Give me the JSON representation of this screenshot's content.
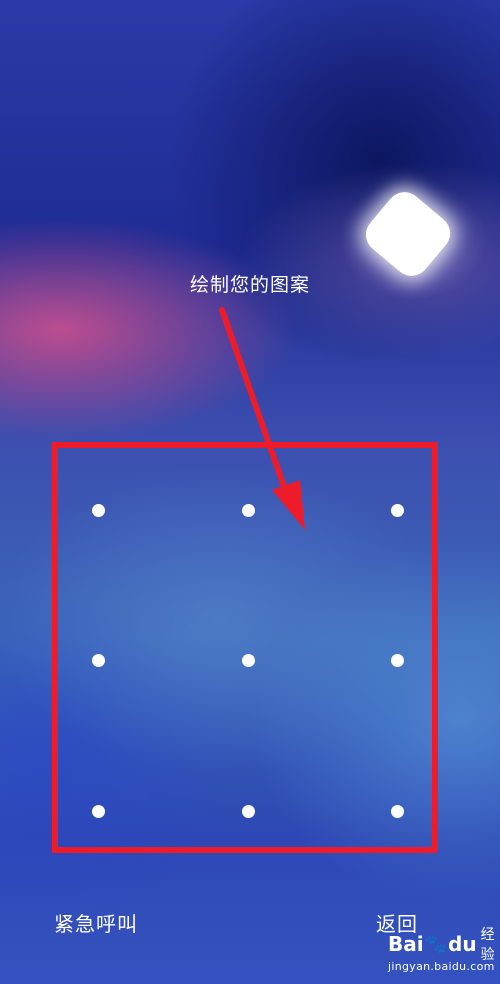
{
  "lockscreen": {
    "prompt": "绘制您的图案",
    "emergency_call": "紧急呼叫",
    "back": "返回"
  },
  "pattern": {
    "rows": 3,
    "cols": 3
  },
  "annotation": {
    "color": "#ee1c2b"
  },
  "watermark": {
    "bai": "Bai",
    "du": "du",
    "jingyan": "经验",
    "url": "jingyan.baidu.com"
  }
}
